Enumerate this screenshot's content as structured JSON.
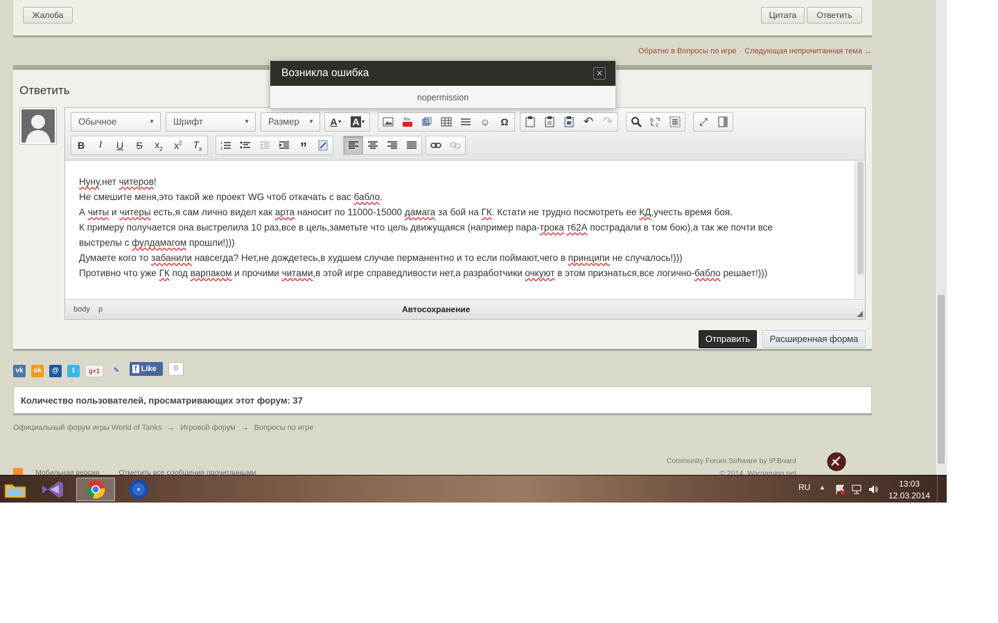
{
  "topbar": {
    "complaint_label": "Жалоба",
    "quote_label": "Цитата",
    "reply_label": "Ответить"
  },
  "nav_links": {
    "back": "Обратно в Вопросы по игре",
    "separator": "·",
    "next": "Следующая непрочитанная тема →"
  },
  "reply": {
    "title": "Ответить",
    "toolbar": {
      "format_select": "Обычное",
      "font_select": "Шрифт",
      "size_select": "Размер"
    },
    "content_lines": [
      [
        {
          "t": "Нуну",
          "s": true
        },
        {
          "t": ",нет "
        },
        {
          "t": "читеров",
          "s": true
        },
        {
          "t": "!"
        }
      ],
      [
        {
          "t": "Не смешите меня,это такой же проект WG чтоб откачать с вас "
        },
        {
          "t": "бабло",
          "s": true
        },
        {
          "t": "."
        }
      ],
      [
        {
          "t": "А "
        },
        {
          "t": "читы",
          "s": true
        },
        {
          "t": " и "
        },
        {
          "t": "читеры",
          "s": true
        },
        {
          "t": " есть,я сам лично видел как "
        },
        {
          "t": "арта",
          "s": true
        },
        {
          "t": " наносит по 11000-15000 "
        },
        {
          "t": "дамага",
          "s": true
        },
        {
          "t": " за бой на "
        },
        {
          "t": "ГК",
          "s": true
        },
        {
          "t": ". Кстати не трудно посмотреть ее "
        },
        {
          "t": "КД",
          "s": true
        },
        {
          "t": ",учесть время боя."
        }
      ],
      [
        {
          "t": "К примеру получается она выстрелила 10 раз,все в цель,заметьте что цель движущаяся (например пара-"
        },
        {
          "t": "трока",
          "s": true
        },
        {
          "t": " "
        },
        {
          "t": "т62А",
          "s": true
        },
        {
          "t": " пострадали в том бою),а так же почти все"
        }
      ],
      [
        {
          "t": "выстрелы с "
        },
        {
          "t": "фулдамагом",
          "s": true
        },
        {
          "t": " прошли!)))"
        }
      ],
      [
        {
          "t": "Думаете кого то "
        },
        {
          "t": "забанили",
          "s": true
        },
        {
          "t": " навсегда? Нет,не дождетесь,в худшем случае перманентно и то если поймают,чего в "
        },
        {
          "t": "принципи",
          "s": true
        },
        {
          "t": " не случалось!)))"
        }
      ],
      [
        {
          "t": "Противно что уже "
        },
        {
          "t": "ГК",
          "s": true
        },
        {
          "t": " под "
        },
        {
          "t": "варпаком",
          "s": true
        },
        {
          "t": " и прочими "
        },
        {
          "t": "читами",
          "s": true
        },
        {
          "t": ",в этой игре справедливости нет,а разработчики "
        },
        {
          "t": "очкуют",
          "s": true
        },
        {
          "t": " в этом признаться,все логично-"
        },
        {
          "t": "бабло",
          "s": true
        },
        {
          "t": " решает!)))"
        }
      ]
    ],
    "status": {
      "path_body": "body",
      "path_p": "p",
      "autosave": "Автосохранение"
    },
    "submit_label": "Отправить",
    "advanced_label": "Расширенная форма"
  },
  "social": {
    "like_label": "Like",
    "like_count": "0",
    "gplus_label": "g+1"
  },
  "users_viewing": "Количество пользователей, просматривающих этот форум: 37",
  "breadcrumb": [
    "Официальный форум игры World of Tanks",
    "Игровой форум",
    "Вопросы по игре"
  ],
  "breadcrumb_arrow": "→",
  "footer": {
    "software": "Community Forum Software by IP.Board",
    "copyright": "© 2014. Wargaming.net",
    "mobile": "Мобильная версия",
    "mark_read": "Отметить все сообщения прочитанными"
  },
  "modal": {
    "title": "Возникла ошибка",
    "message": "nopermission",
    "close_glyph": "✕"
  },
  "taskbar": {
    "lang": "RU",
    "time": "13:03",
    "date": "12.03.2014"
  },
  "colors": {
    "page_bg": "#d9d8c9",
    "panel_border": "#a9a899",
    "link": "#a0473a",
    "modal_header": "#2f2e28",
    "submit_bg": "#2c2c2c"
  }
}
